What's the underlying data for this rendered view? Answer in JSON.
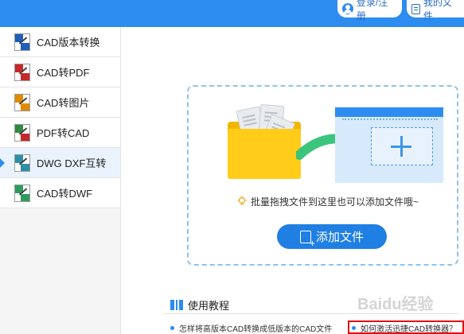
{
  "header": {
    "login_label": "登录/注册",
    "my_files_label": "我的文件"
  },
  "sidebar": {
    "items": [
      {
        "label": "CAD版本转换",
        "icon": "cad-version-icon",
        "active": false
      },
      {
        "label": "CAD转PDF",
        "icon": "cad-to-pdf-icon",
        "active": false
      },
      {
        "label": "CAD转图片",
        "icon": "cad-to-image-icon",
        "active": false
      },
      {
        "label": "PDF转CAD",
        "icon": "pdf-to-cad-icon",
        "active": false
      },
      {
        "label": "DWG DXF互转",
        "icon": "dwg-dxf-icon",
        "active": true
      },
      {
        "label": "CAD转DWF",
        "icon": "cad-to-dwf-icon",
        "active": false
      }
    ]
  },
  "main": {
    "drop_hint": "批量拖拽文件到这里也可以添加文件哦~",
    "add_file_label": "添加文件"
  },
  "tutorial": {
    "heading": "使用教程",
    "links": [
      "怎样将高版本CAD转换成低版本的CAD文件",
      "如何激活迅捷CAD转换器？"
    ]
  },
  "watermark": "Baidu经验",
  "colors": {
    "accent": "#2d8cf0",
    "button": "#1f7fe3",
    "highlight": "#e01010"
  }
}
